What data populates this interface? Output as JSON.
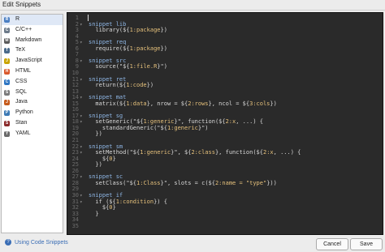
{
  "window": {
    "title": "Edit Snippets"
  },
  "languages": [
    {
      "label": "R",
      "color": "#4a7ec2",
      "glyph": "R"
    },
    {
      "label": "C/C++",
      "color": "#6c7a89",
      "glyph": "C"
    },
    {
      "label": "Markdown",
      "color": "#5a5a5a",
      "glyph": "M"
    },
    {
      "label": "TeX",
      "color": "#4a6a8a",
      "glyph": "T"
    },
    {
      "label": "JavaScript",
      "color": "#c9a400",
      "glyph": "J"
    },
    {
      "label": "HTML",
      "color": "#d9582c",
      "glyph": "H"
    },
    {
      "label": "CSS",
      "color": "#2f76c3",
      "glyph": "C"
    },
    {
      "label": "SQL",
      "color": "#7a7a7a",
      "glyph": "S"
    },
    {
      "label": "Java",
      "color": "#c55a1a",
      "glyph": "J"
    },
    {
      "label": "Python",
      "color": "#3d7ab5",
      "glyph": "P"
    },
    {
      "label": "Stan",
      "color": "#8a2a2a",
      "glyph": "S"
    },
    {
      "label": "YAML",
      "color": "#6a6a6a",
      "glyph": "Y"
    }
  ],
  "selected_language": "R",
  "code_lines": [
    {
      "n": "1",
      "f": "",
      "segs": []
    },
    {
      "n": "2",
      "f": "▾",
      "segs": [
        [
          "kw",
          "snippet lib"
        ]
      ]
    },
    {
      "n": "3",
      "f": "",
      "segs": [
        [
          "tx",
          "  library(${"
        ],
        [
          "ph",
          "1:package"
        ],
        [
          "tx",
          "})"
        ]
      ]
    },
    {
      "n": "4",
      "f": "",
      "segs": []
    },
    {
      "n": "5",
      "f": "▾",
      "segs": [
        [
          "kw",
          "snippet req"
        ]
      ]
    },
    {
      "n": "6",
      "f": "",
      "segs": [
        [
          "tx",
          "  require(${"
        ],
        [
          "ph",
          "1:package"
        ],
        [
          "tx",
          "})"
        ]
      ]
    },
    {
      "n": "7",
      "f": "",
      "segs": []
    },
    {
      "n": "8",
      "f": "▾",
      "segs": [
        [
          "kw",
          "snippet src"
        ]
      ]
    },
    {
      "n": "9",
      "f": "",
      "segs": [
        [
          "tx",
          "  source(\"${"
        ],
        [
          "ph",
          "1:file.R"
        ],
        [
          "tx",
          "}\")"
        ]
      ]
    },
    {
      "n": "10",
      "f": "",
      "segs": []
    },
    {
      "n": "11",
      "f": "▾",
      "segs": [
        [
          "kw",
          "snippet ret"
        ]
      ]
    },
    {
      "n": "12",
      "f": "",
      "segs": [
        [
          "tx",
          "  return(${"
        ],
        [
          "ph",
          "1:code"
        ],
        [
          "tx",
          "})"
        ]
      ]
    },
    {
      "n": "13",
      "f": "",
      "segs": []
    },
    {
      "n": "14",
      "f": "▾",
      "segs": [
        [
          "kw",
          "snippet mat"
        ]
      ]
    },
    {
      "n": "15",
      "f": "",
      "segs": [
        [
          "tx",
          "  matrix(${"
        ],
        [
          "ph",
          "1:data"
        ],
        [
          "tx",
          "}, nrow = ${"
        ],
        [
          "ph",
          "2:rows"
        ],
        [
          "tx",
          "}, ncol = ${"
        ],
        [
          "ph",
          "3:cols"
        ],
        [
          "tx",
          "})"
        ]
      ]
    },
    {
      "n": "16",
      "f": "",
      "segs": []
    },
    {
      "n": "17",
      "f": "▾",
      "segs": [
        [
          "kw",
          "snippet sg"
        ]
      ]
    },
    {
      "n": "18",
      "f": "▾",
      "segs": [
        [
          "tx",
          "  setGeneric(\"${"
        ],
        [
          "ph",
          "1:generic"
        ],
        [
          "tx",
          "}\", function(${"
        ],
        [
          "ph",
          "2:x"
        ],
        [
          "tx",
          ", ...) {"
        ]
      ]
    },
    {
      "n": "19",
      "f": "",
      "segs": [
        [
          "tx",
          "    standardGeneric(\"${"
        ],
        [
          "ph",
          "1:generic"
        ],
        [
          "tx",
          "}\")"
        ]
      ]
    },
    {
      "n": "20",
      "f": "",
      "segs": [
        [
          "tx",
          "  })"
        ]
      ]
    },
    {
      "n": "21",
      "f": "",
      "segs": []
    },
    {
      "n": "22",
      "f": "▾",
      "segs": [
        [
          "kw",
          "snippet sm"
        ]
      ]
    },
    {
      "n": "23",
      "f": "▾",
      "segs": [
        [
          "tx",
          "  setMethod(\"${"
        ],
        [
          "ph",
          "1:generic"
        ],
        [
          "tx",
          "}\", ${"
        ],
        [
          "ph",
          "2:class"
        ],
        [
          "tx",
          "}, function(${"
        ],
        [
          "ph",
          "2:x"
        ],
        [
          "tx",
          ", ...) {"
        ]
      ]
    },
    {
      "n": "24",
      "f": "",
      "segs": [
        [
          "tx",
          "    ${"
        ],
        [
          "ph",
          "0"
        ],
        [
          "tx",
          "}"
        ]
      ]
    },
    {
      "n": "25",
      "f": "",
      "segs": [
        [
          "tx",
          "  })"
        ]
      ]
    },
    {
      "n": "26",
      "f": "",
      "segs": []
    },
    {
      "n": "27",
      "f": "▾",
      "segs": [
        [
          "kw",
          "snippet sc"
        ]
      ]
    },
    {
      "n": "28",
      "f": "",
      "segs": [
        [
          "tx",
          "  setClass(\"${"
        ],
        [
          "ph",
          "1:Class"
        ],
        [
          "tx",
          "}\", slots = c(${"
        ],
        [
          "ph",
          "2:name = \"type\""
        ],
        [
          "tx",
          "}))"
        ]
      ]
    },
    {
      "n": "29",
      "f": "",
      "segs": []
    },
    {
      "n": "30",
      "f": "▾",
      "segs": [
        [
          "kw",
          "snippet if"
        ]
      ]
    },
    {
      "n": "31",
      "f": "▾",
      "segs": [
        [
          "tx",
          "  if (${"
        ],
        [
          "ph",
          "1:condition"
        ],
        [
          "tx",
          "}) {"
        ]
      ]
    },
    {
      "n": "32",
      "f": "",
      "segs": [
        [
          "tx",
          "    ${"
        ],
        [
          "ph",
          "0"
        ],
        [
          "tx",
          "}"
        ]
      ]
    },
    {
      "n": "33",
      "f": "",
      "segs": [
        [
          "tx",
          "  }"
        ]
      ]
    },
    {
      "n": "34",
      "f": "",
      "segs": []
    },
    {
      "n": "35",
      "f": "",
      "segs": []
    }
  ],
  "footer": {
    "help_link": "Using Code Snippets",
    "cancel_label": "Cancel",
    "save_label": "Save"
  }
}
